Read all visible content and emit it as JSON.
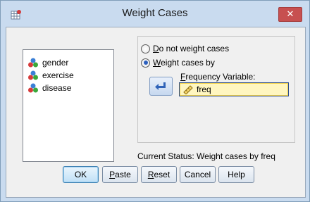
{
  "window": {
    "title": "Weight Cases",
    "close_glyph": "✕"
  },
  "variables": [
    {
      "label": "gender",
      "icon": "nominal-variable-icon"
    },
    {
      "label": "exercise",
      "icon": "nominal-variable-icon"
    },
    {
      "label": "disease",
      "icon": "nominal-variable-icon"
    }
  ],
  "weight_options": {
    "do_not": {
      "mnemonic": "D",
      "rest": "o not weight cases",
      "selected": false
    },
    "weight_by": {
      "mnemonic": "W",
      "rest": "eight cases by",
      "selected": true
    },
    "frequency_label": {
      "mnemonic": "F",
      "rest": "requency Variable:"
    },
    "frequency_value": "freq"
  },
  "status": "Current Status: Weight cases by freq",
  "buttons": {
    "ok": "OK",
    "paste": {
      "mnemonic": "P",
      "rest": "aste"
    },
    "reset": {
      "mnemonic": "R",
      "rest": "eset"
    },
    "cancel": "Cancel",
    "help": "Help"
  },
  "colors": {
    "titlebar": "#c9dbef",
    "close": "#c75050",
    "field_highlight": "#fff6c0"
  }
}
